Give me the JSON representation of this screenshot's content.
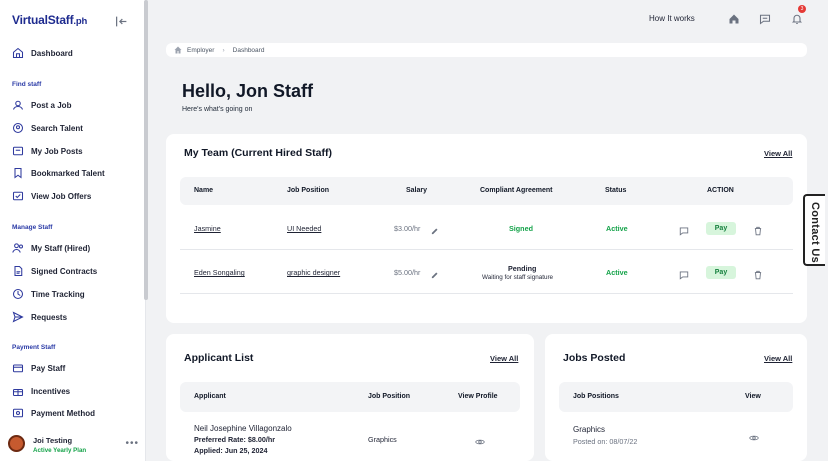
{
  "brand": {
    "name": "VirtualStaff",
    "suffix": ".ph"
  },
  "sidebar": {
    "items": [
      {
        "label": "Dashboard",
        "icon": "home-icon"
      },
      {
        "label": "Post a Job",
        "icon": "post-job-icon"
      },
      {
        "label": "Search Talent",
        "icon": "search-icon"
      },
      {
        "label": "My Job Posts",
        "icon": "briefcase-icon"
      },
      {
        "label": "Bookmarked Talent",
        "icon": "bookmark-icon"
      },
      {
        "label": "View Job Offers",
        "icon": "offers-icon"
      },
      {
        "label": "My Staff (Hired)",
        "icon": "staff-icon"
      },
      {
        "label": "Signed Contracts",
        "icon": "contract-icon"
      },
      {
        "label": "Time Tracking",
        "icon": "clock-icon"
      },
      {
        "label": "Requests",
        "icon": "send-icon"
      },
      {
        "label": "Pay Staff",
        "icon": "pay-icon"
      },
      {
        "label": "Incentives",
        "icon": "gift-icon"
      },
      {
        "label": "Payment Method",
        "icon": "card-icon"
      }
    ],
    "sections": {
      "find": "Find staff",
      "manage": "Manage Staff",
      "payment": "Payment Staff"
    },
    "user": {
      "name": "Joi Testing",
      "plan": "Active Yearly Plan"
    }
  },
  "topbar": {
    "how_it_works": "How It works",
    "notif_count": "3"
  },
  "breadcrumb": [
    "Employer",
    "Dashboard"
  ],
  "greeting": {
    "title": "Hello, Jon Staff",
    "subtitle": "Here's what's going on"
  },
  "team": {
    "title": "My Team (Current Hired Staff)",
    "view_all": "View All",
    "headers": [
      "Name",
      "Job Position",
      "Salary",
      "Compliant Agreement",
      "Status",
      "ACTION"
    ],
    "rows": [
      {
        "name": "Jasmine",
        "position": "UI Needed",
        "salary": "$3.00/hr",
        "agreement": "Signed",
        "agreement_note": "",
        "status": "Active",
        "pay": "Pay"
      },
      {
        "name": "Eden Songaling",
        "position": "graphic designer",
        "salary": "$5.00/hr",
        "agreement": "Pending",
        "agreement_note": "Waiting for staff signature",
        "status": "Active",
        "pay": "Pay"
      }
    ]
  },
  "applicants": {
    "title": "Applicant List",
    "view_all": "View All",
    "headers": [
      "Applicant",
      "Job Position",
      "View Profile"
    ],
    "rows": [
      {
        "name": "Neil Josephine Villagonzalo",
        "rate": "Preferred Rate: $8.00/hr",
        "applied": "Applied: Jun 25, 2024",
        "position": "Graphics"
      }
    ]
  },
  "jobs": {
    "title": "Jobs Posted",
    "view_all": "View All",
    "headers": [
      "Job Positions",
      "View"
    ],
    "rows": [
      {
        "title": "Graphics",
        "posted": "Posted on: 08/07/22"
      }
    ]
  },
  "contact_tab": "Contact Us",
  "colors": {
    "brand": "#1e2b8f",
    "accent": "#2a3aa6",
    "active": "#15a34a",
    "pay_bg": "#d7f5dc"
  }
}
